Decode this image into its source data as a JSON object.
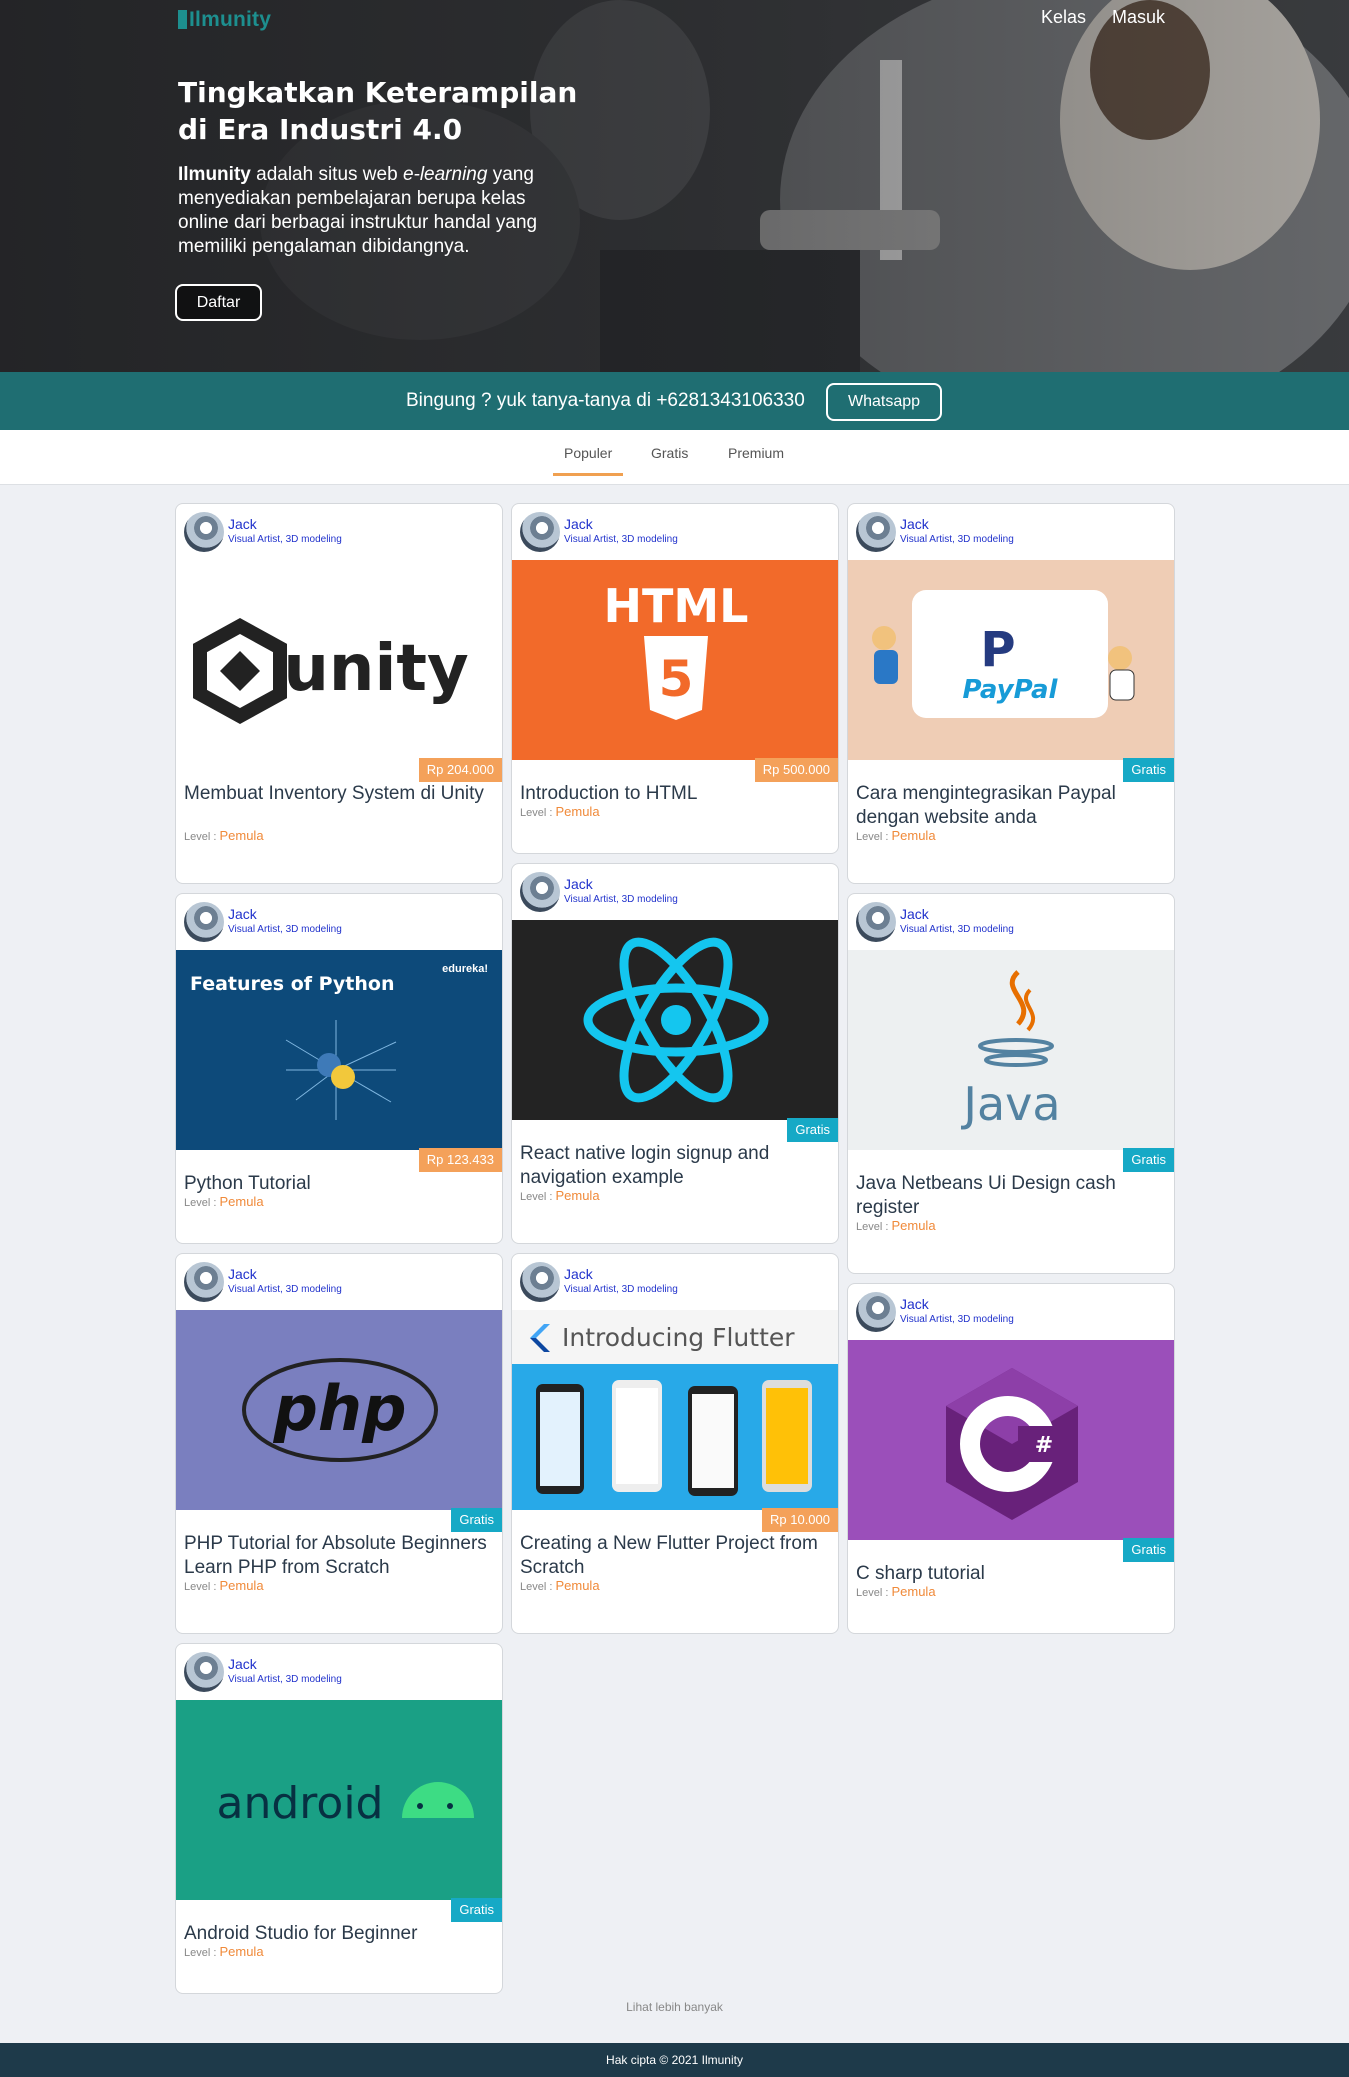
{
  "brand": {
    "name": "Ilmunity"
  },
  "nav": {
    "items": [
      "Kelas",
      "Masuk"
    ]
  },
  "hero": {
    "title_line1": "Tingkatkan Keterampilan",
    "title_line2": "di Era Industri 4.0",
    "desc_brand": "Ilmunity",
    "desc_part1": " adalah situs web ",
    "desc_italic": "e-learning",
    "desc_part2": " yang menyediakan pembelajaran berupa kelas online dari berbagai instruktur handal yang memiliki pengalaman dibidangnya.",
    "button": "Daftar"
  },
  "whatsapp": {
    "text": "Bingung ? yuk tanya-tanya di +6281343106330",
    "button": "Whatsapp"
  },
  "tabs": [
    "Populer",
    "Gratis",
    "Premium"
  ],
  "level_label": "Level : ",
  "cards": [
    {
      "author": "Jack",
      "role": "Visual Artist, 3D modeling",
      "thumb": "unity",
      "thumb_text": "unity",
      "price": "Rp 204.000",
      "price_type": "paid",
      "title": "Membuat Inventory System di Unity",
      "level": "Pemula"
    },
    {
      "author": "Jack",
      "role": "Visual Artist, 3D modeling",
      "thumb": "html",
      "thumb_text": "HTML",
      "price": "Rp 500.000",
      "price_type": "paid",
      "title": "Introduction to HTML",
      "level": "Pemula"
    },
    {
      "author": "Jack",
      "role": "Visual Artist, 3D modeling",
      "thumb": "paypal",
      "thumb_text": "PayPal",
      "price": "Gratis",
      "price_type": "free",
      "title": "Cara mengintegrasikan Paypal dengan website anda",
      "level": "Pemula"
    },
    {
      "author": "Jack",
      "role": "Visual Artist, 3D modeling",
      "thumb": "python",
      "thumb_text": "Features of Python",
      "thumb_sub": "edureka!",
      "price": "Rp 123.433",
      "price_type": "paid",
      "title": "Python Tutorial",
      "level": "Pemula"
    },
    {
      "author": "Jack",
      "role": "Visual Artist, 3D modeling",
      "thumb": "react",
      "thumb_text": "",
      "price": "Gratis",
      "price_type": "free",
      "title": "React native login signup and navigation example",
      "level": "Pemula"
    },
    {
      "author": "Jack",
      "role": "Visual Artist, 3D modeling",
      "thumb": "java",
      "thumb_text": "Java",
      "price": "Gratis",
      "price_type": "free",
      "title": "Java Netbeans Ui Design cash register",
      "level": "Pemula"
    },
    {
      "author": "Jack",
      "role": "Visual Artist, 3D modeling",
      "thumb": "php",
      "thumb_text": "php",
      "price": "Gratis",
      "price_type": "free",
      "title": "PHP Tutorial for Absolute Beginners Learn PHP from Scratch",
      "level": "Pemula"
    },
    {
      "author": "Jack",
      "role": "Visual Artist, 3D modeling",
      "thumb": "flutter",
      "thumb_text": "Introducing Flutter",
      "price": "Rp 10.000",
      "price_type": "paid",
      "title": "Creating a New Flutter Project from Scratch",
      "level": "Pemula"
    },
    {
      "author": "Jack",
      "role": "Visual Artist, 3D modeling",
      "thumb": "csharp",
      "thumb_text": "C#",
      "price": "Gratis",
      "price_type": "free",
      "title": "C sharp tutorial",
      "level": "Pemula"
    },
    {
      "author": "Jack",
      "role": "Visual Artist, 3D modeling",
      "thumb": "android",
      "thumb_text": "android",
      "price": "Gratis",
      "price_type": "free",
      "title": "Android Studio for Beginner",
      "level": "Pemula"
    }
  ],
  "more_link": "Lihat lebih banyak",
  "footer": "Hak cipta © 2021 Ilmunity"
}
